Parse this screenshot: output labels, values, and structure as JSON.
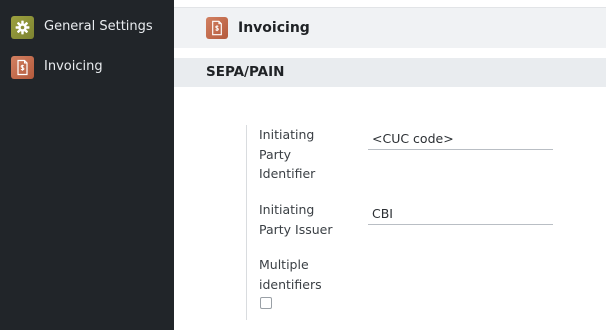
{
  "sidebar": {
    "items": [
      {
        "label": "General Settings",
        "icon": "gear-icon"
      },
      {
        "label": "Invoicing",
        "icon": "invoice-icon"
      }
    ]
  },
  "header": {
    "title": "Invoicing",
    "icon": "invoice-icon"
  },
  "section": {
    "title": "SEPA/PAIN"
  },
  "fields": {
    "initiating_party_identifier": {
      "label_lines": [
        "Initiating",
        "Party",
        "Identifier"
      ],
      "value": "<CUC code>"
    },
    "initiating_party_issuer": {
      "label_lines": [
        "Initiating",
        "Party Issuer"
      ],
      "value": "CBI"
    },
    "multiple_identifiers": {
      "label_lines": [
        "Multiple",
        "identifiers"
      ],
      "checked": false
    }
  },
  "colors": {
    "sidebar_bg": "#212529",
    "settings_icon": "#9ca13f",
    "invoicing_icon": "#c76b4d",
    "header_bg": "#f0f2f4",
    "section_bg": "#e9ecef"
  }
}
